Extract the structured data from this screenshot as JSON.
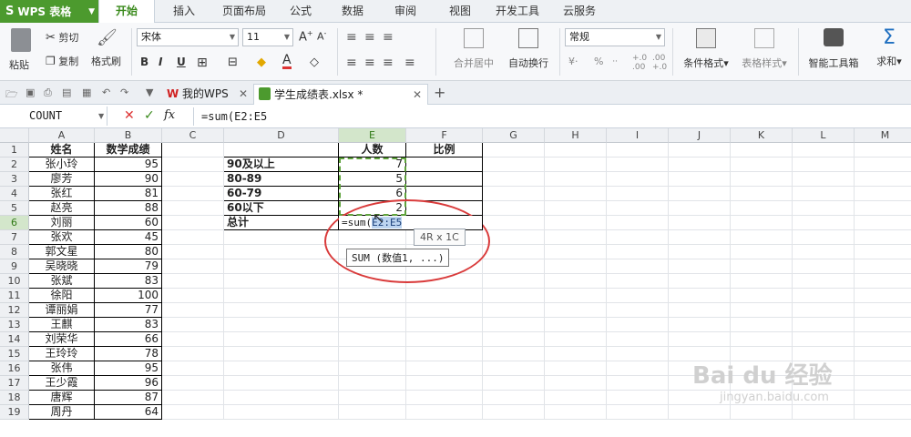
{
  "app": {
    "title": "WPS 表格"
  },
  "menu_tabs": [
    "开始",
    "插入",
    "页面布局",
    "公式",
    "数据",
    "审阅",
    "视图",
    "开发工具",
    "云服务"
  ],
  "ribbon": {
    "paste": "粘贴",
    "cut": "剪切",
    "copy": "复制",
    "format_painter": "格式刷",
    "font_name": "宋体",
    "font_size": "11",
    "merge_center": "合并居中",
    "wrap_text": "自动换行",
    "number_format": "常规",
    "percent": "%",
    "conditional_format": "条件格式",
    "table_style": "表格样式",
    "smart_toolbox": "智能工具箱",
    "sum": "求和",
    "bold": "B",
    "italic": "I",
    "underline": "U"
  },
  "doc_tabs": [
    {
      "label": "我的WPS"
    },
    {
      "label": "学生成绩表.xlsx *"
    }
  ],
  "formula_bar": {
    "name_box": "COUNT",
    "formula": "=sum(E2:E5",
    "fx": "fx"
  },
  "columns": [
    "A",
    "B",
    "C",
    "D",
    "E",
    "F",
    "G",
    "H",
    "I",
    "J",
    "K",
    "L",
    "M"
  ],
  "rows": [
    "1",
    "2",
    "3",
    "4",
    "5",
    "6",
    "7",
    "8",
    "9",
    "10",
    "11",
    "12",
    "13",
    "14",
    "15",
    "16",
    "17",
    "18",
    "19"
  ],
  "table_a": {
    "headers": [
      "姓名",
      "数学成绩"
    ],
    "rows": [
      [
        "张小玲",
        "95"
      ],
      [
        "廖芳",
        "90"
      ],
      [
        "张红",
        "81"
      ],
      [
        "赵亮",
        "88"
      ],
      [
        "刘丽",
        "60"
      ],
      [
        "张欢",
        "45"
      ],
      [
        "郭文星",
        "80"
      ],
      [
        "吴晓晓",
        "79"
      ],
      [
        "张斌",
        "83"
      ],
      [
        "徐阳",
        "100"
      ],
      [
        "谭丽娟",
        "77"
      ],
      [
        "王麒",
        "83"
      ],
      [
        "刘荣华",
        "66"
      ],
      [
        "王玲玲",
        "78"
      ],
      [
        "张伟",
        "95"
      ],
      [
        "王少霞",
        "96"
      ],
      [
        "唐辉",
        "87"
      ],
      [
        "周丹",
        "64"
      ]
    ]
  },
  "table_b": {
    "headers": [
      "",
      "人数",
      "比例"
    ],
    "rows": [
      [
        "90及以上",
        "7"
      ],
      [
        "80-89",
        "5"
      ],
      [
        "60-79",
        "6"
      ],
      [
        "60以下",
        "2"
      ]
    ],
    "total_label": "总计",
    "editing": "=sum(",
    "editing_ref": "E2:E5"
  },
  "tooltip": "4R x 1C",
  "func_hint": "SUM (数值1, ...)",
  "watermark": {
    "brand": "Bai du 经验",
    "url": "jingyan.baidu.com"
  }
}
